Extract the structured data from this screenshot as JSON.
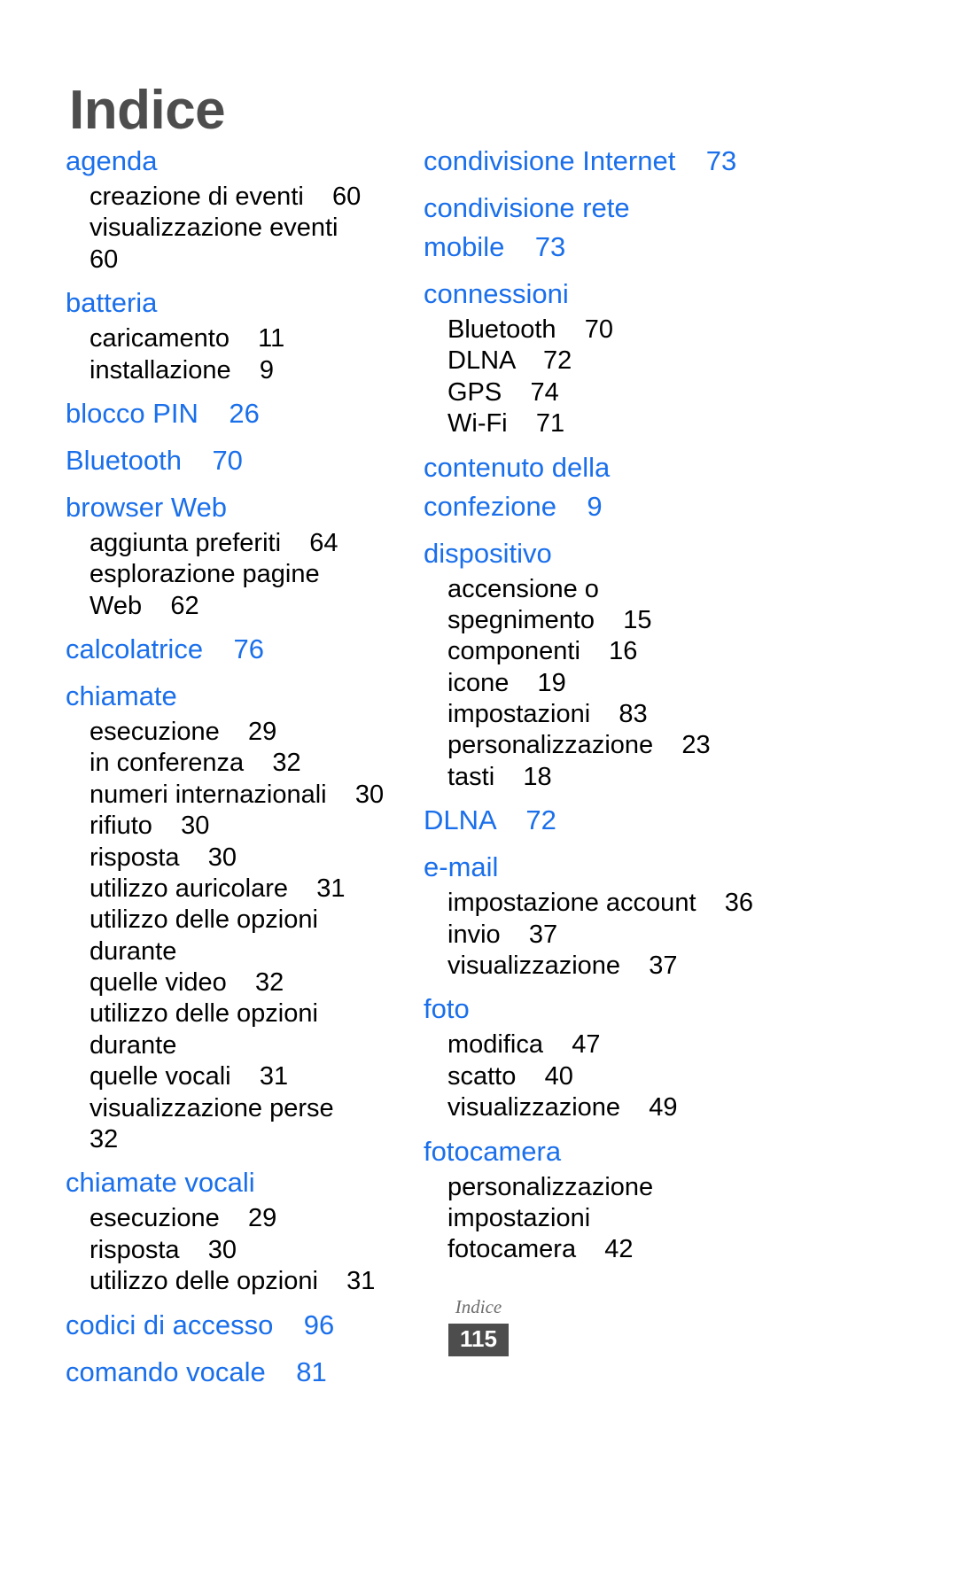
{
  "document": {
    "title": "Indice",
    "footer_label": "Indice",
    "page_number": "115",
    "heading_color": "#1a6feb",
    "title_color": "#4d4d4d",
    "body_color": "#000000",
    "badge_bg": "#4d4d4d"
  },
  "columns": {
    "left": [
      {
        "heading": "agenda",
        "subentries": [
          "creazione di eventi    60",
          "visualizzazione eventi    60"
        ]
      },
      {
        "heading": "batteria",
        "subentries": [
          "caricamento    11",
          "installazione    9"
        ]
      },
      {
        "heading": "blocco PIN    26",
        "subentries": []
      },
      {
        "heading": "Bluetooth    70",
        "subentries": []
      },
      {
        "heading": "browser Web",
        "subentries": [
          "aggiunta preferiti    64",
          "esplorazione pagine\nWeb    62"
        ]
      },
      {
        "heading": "calcolatrice    76",
        "subentries": []
      },
      {
        "heading": "chiamate",
        "subentries": [
          "esecuzione    29",
          "in conferenza    32",
          "numeri internazionali    30",
          "rifiuto    30",
          "risposta    30",
          "utilizzo auricolare    31",
          "utilizzo delle opzioni durante\nquelle video    32",
          "utilizzo delle opzioni durante\nquelle vocali    31",
          "visualizzazione perse    32"
        ]
      },
      {
        "heading": "chiamate vocali",
        "subentries": [
          "esecuzione    29",
          "risposta    30",
          "utilizzo delle opzioni    31"
        ]
      },
      {
        "heading": "codici di accesso    96",
        "subentries": []
      },
      {
        "heading": "comando vocale    81",
        "subentries": []
      }
    ],
    "right": [
      {
        "heading": "condivisione Internet    73",
        "subentries": []
      },
      {
        "heading": "condivisione rete\nmobile    73",
        "subentries": []
      },
      {
        "heading": "connessioni",
        "subentries": [
          "Bluetooth    70",
          "DLNA    72",
          "GPS    74",
          "Wi-Fi    71"
        ]
      },
      {
        "heading": "contenuto della\nconfezione    9",
        "subentries": []
      },
      {
        "heading": "dispositivo",
        "subentries": [
          "accensione o\nspegnimento    15",
          "componenti    16",
          "icone    19",
          "impostazioni    83",
          "personalizzazione    23",
          "tasti    18"
        ]
      },
      {
        "heading": "DLNA    72",
        "subentries": []
      },
      {
        "heading": "e-mail",
        "subentries": [
          "impostazione account    36",
          "invio    37",
          "visualizzazione    37"
        ]
      },
      {
        "heading": "foto",
        "subentries": [
          "modifica    47",
          "scatto    40",
          "visualizzazione    49"
        ]
      },
      {
        "heading": "fotocamera",
        "subentries": [
          "personalizzazione\nimpostazioni\nfotocamera    42"
        ]
      }
    ]
  }
}
